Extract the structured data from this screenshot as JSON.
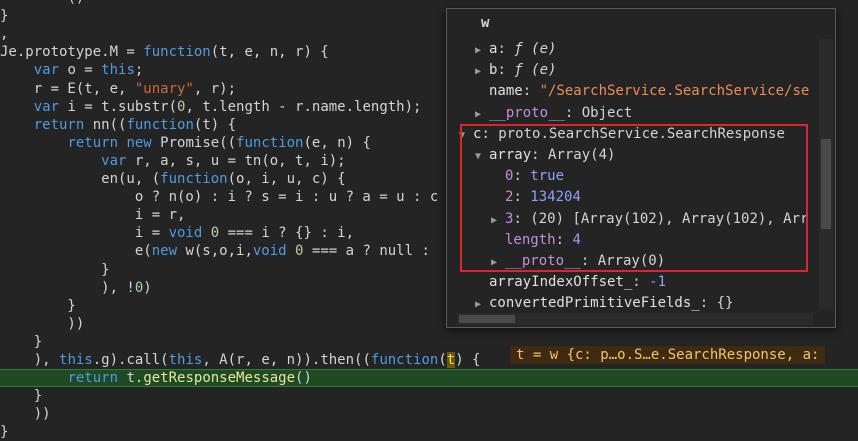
{
  "code": {
    "lines": [
      {
        "id": "l0",
        "parts": [
          [
            "p",
            "        "
          ],
          [
            "p",
            "("
          ],
          [
            "p",
            ")"
          ]
        ]
      },
      {
        "id": "l1",
        "parts": [
          [
            "p",
            "}"
          ]
        ]
      },
      {
        "id": "l2",
        "parts": [
          [
            "p",
            ","
          ]
        ]
      },
      {
        "id": "l3",
        "parts": [
          [
            "p",
            "Je.prototype.M = "
          ],
          [
            "kw",
            "function"
          ],
          [
            "p",
            "(t, e, n, r) {"
          ]
        ]
      },
      {
        "id": "l4",
        "parts": [
          [
            "p",
            "    "
          ],
          [
            "kw",
            "var"
          ],
          [
            "p",
            " o = "
          ],
          [
            "kw",
            "this"
          ],
          [
            "p",
            ";"
          ]
        ]
      },
      {
        "id": "l5",
        "parts": [
          [
            "p",
            "    r = E(t, e, "
          ],
          [
            "str",
            "\"unary\""
          ],
          [
            "p",
            ", r);"
          ]
        ]
      },
      {
        "id": "l6",
        "parts": [
          [
            "p",
            "    "
          ],
          [
            "kw",
            "var"
          ],
          [
            "p",
            " i = t.substr("
          ],
          [
            "num",
            "0"
          ],
          [
            "p",
            ", t.length - r.name.length);"
          ]
        ]
      },
      {
        "id": "l7",
        "parts": [
          [
            "p",
            "    "
          ],
          [
            "kw",
            "return"
          ],
          [
            "p",
            " nn(("
          ],
          [
            "kw",
            "function"
          ],
          [
            "p",
            "(t) {"
          ]
        ]
      },
      {
        "id": "l8",
        "parts": [
          [
            "p",
            "        "
          ],
          [
            "kw",
            "return"
          ],
          [
            "p",
            " "
          ],
          [
            "kw",
            "new"
          ],
          [
            "p",
            " Promise(("
          ],
          [
            "kw",
            "function"
          ],
          [
            "p",
            "(e, n) {"
          ]
        ]
      },
      {
        "id": "l9",
        "parts": [
          [
            "p",
            "            "
          ],
          [
            "kw",
            "var"
          ],
          [
            "p",
            " r, a, s, u = tn(o, t, i);"
          ]
        ]
      },
      {
        "id": "l10",
        "parts": [
          [
            "p",
            "            en(u, ("
          ],
          [
            "kw",
            "function"
          ],
          [
            "p",
            "(o, i, u, c) {"
          ]
        ]
      },
      {
        "id": "l11",
        "parts": [
          [
            "p",
            "                o ? n(o) : i ? s = i : u ? a = u : c"
          ]
        ]
      },
      {
        "id": "l12",
        "parts": [
          [
            "p",
            "                i = r,"
          ]
        ]
      },
      {
        "id": "l13",
        "parts": [
          [
            "p",
            "                i = "
          ],
          [
            "kw",
            "void"
          ],
          [
            "p",
            " "
          ],
          [
            "num",
            "0"
          ],
          [
            "p",
            " === i ? {} : i,"
          ]
        ]
      },
      {
        "id": "l14",
        "parts": [
          [
            "p",
            "                e("
          ],
          [
            "kw",
            "new"
          ],
          [
            "p",
            " w(s,o,i,"
          ],
          [
            "kw",
            "void"
          ],
          [
            "p",
            " "
          ],
          [
            "num",
            "0"
          ],
          [
            "p",
            " === a ? null :"
          ]
        ]
      },
      {
        "id": "l15",
        "parts": [
          [
            "p",
            "            }"
          ]
        ]
      },
      {
        "id": "l16",
        "parts": [
          [
            "p",
            "            ), !"
          ],
          [
            "num",
            "0"
          ],
          [
            "p",
            ")"
          ]
        ]
      },
      {
        "id": "l17",
        "parts": [
          [
            "p",
            "        }"
          ]
        ]
      },
      {
        "id": "l18",
        "parts": [
          [
            "p",
            "        ))"
          ]
        ]
      },
      {
        "id": "l19",
        "parts": [
          [
            "p",
            "    }"
          ]
        ]
      },
      {
        "id": "l20",
        "parts": [
          [
            "p",
            "    ), "
          ],
          [
            "kw",
            "this"
          ],
          [
            "p",
            ".g).call("
          ],
          [
            "kw",
            "this"
          ],
          [
            "p",
            ", A(r, e, n)).then(("
          ],
          [
            "kw",
            "function"
          ],
          [
            "p",
            "("
          ],
          [
            "cur",
            "t"
          ],
          [
            "p",
            ") {"
          ]
        ]
      },
      {
        "id": "l21",
        "hl": true,
        "parts": [
          [
            "p",
            "        "
          ],
          [
            "kw",
            "return"
          ],
          [
            "p",
            " t."
          ],
          [
            "fn",
            "getResponseMessage"
          ],
          [
            "p",
            "()"
          ]
        ]
      },
      {
        "id": "l22",
        "parts": [
          [
            "p",
            "    }"
          ]
        ]
      },
      {
        "id": "l23",
        "parts": [
          [
            "p",
            "    ))"
          ]
        ]
      },
      {
        "id": "l24",
        "parts": [
          [
            "p",
            "}"
          ]
        ]
      }
    ],
    "inline_value": "t = w {c: p…o.S…e.SearchResponse, a:"
  },
  "tooltip": {
    "title": "w",
    "rows": [
      {
        "indent": 1,
        "tri": "▶",
        "key": "a",
        "sep": ": ",
        "val": "ƒ (e)",
        "cls": "fnv"
      },
      {
        "indent": 1,
        "tri": "▶",
        "key": "b",
        "sep": ": ",
        "val": "ƒ (e)",
        "cls": "fnv"
      },
      {
        "indent": 1,
        "tri": "",
        "key": "name",
        "sep": ": ",
        "val": "\"/SearchService.SearchService/se",
        "cls": "val-str"
      },
      {
        "indent": 1,
        "tri": "▶",
        "key": "__proto__",
        "sep": ": ",
        "val": "Object",
        "cls": "plain",
        "keycls": "purple"
      },
      {
        "indent": 0,
        "tri": "▼",
        "key": "c",
        "sep": ": ",
        "val": "proto.SearchService.SearchResponse",
        "cls": "plain"
      },
      {
        "indent": 1,
        "tri": "▼",
        "key": "array",
        "sep": ": ",
        "val": "Array(4)",
        "cls": "plain"
      },
      {
        "indent": 2,
        "tri": "",
        "key": "0",
        "sep": ": ",
        "val": "true",
        "cls": "val-bool",
        "keycls": "purple"
      },
      {
        "indent": 2,
        "tri": "",
        "key": "2",
        "sep": ": ",
        "val": "134204",
        "cls": "val-num",
        "keycls": "purple"
      },
      {
        "indent": 2,
        "tri": "▶",
        "key": "3",
        "sep": ": ",
        "val": "(20) [Array(102), Array(102), Arr",
        "cls": "plain",
        "keycls": "purple"
      },
      {
        "indent": 2,
        "tri": "",
        "key": "length",
        "sep": ": ",
        "val": "4",
        "cls": "val-num",
        "keycls": "purple"
      },
      {
        "indent": 2,
        "tri": "▶",
        "key": "__proto__",
        "sep": ": ",
        "val": "Array(0)",
        "cls": "plain",
        "keycls": "purple"
      },
      {
        "indent": 1,
        "tri": "",
        "key": "arrayIndexOffset_",
        "sep": ": ",
        "val": "-1",
        "cls": "val-num"
      },
      {
        "indent": 1,
        "tri": "▶",
        "key": "convertedPrimitiveFields_",
        "sep": ": ",
        "val": "{}",
        "cls": "plain"
      }
    ]
  }
}
